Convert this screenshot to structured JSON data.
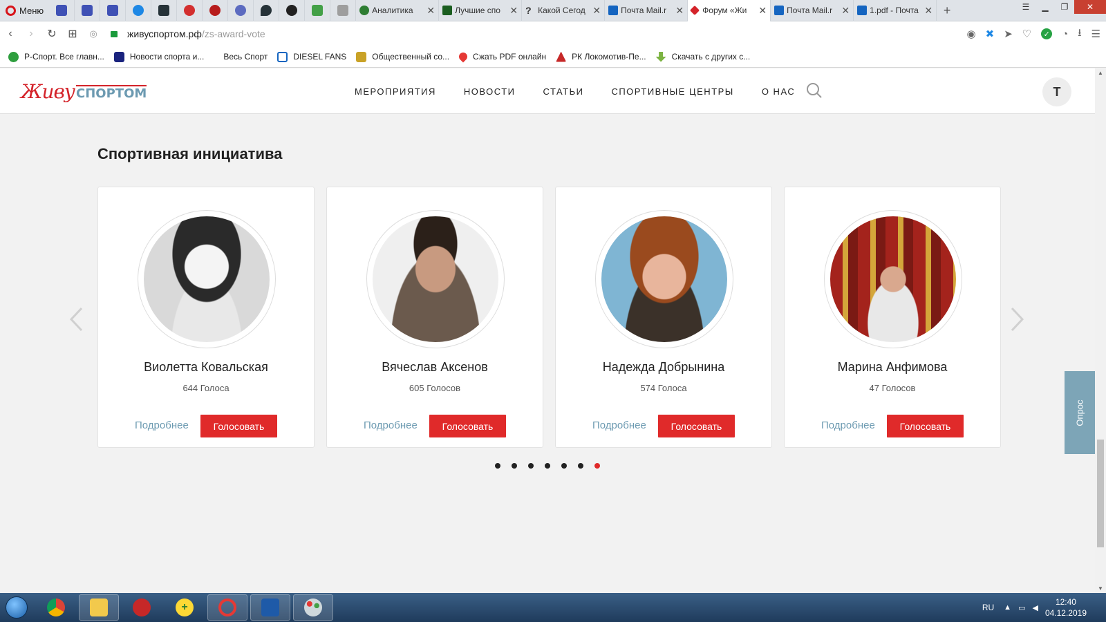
{
  "browser": {
    "menu_label": "Меню",
    "tabs": [
      {
        "label": "Аналитика",
        "color": "#2e7d32"
      },
      {
        "label": "Лучшие спо",
        "color": "#1b5e20"
      },
      {
        "label": "Какой Сегод",
        "color": "#222222"
      },
      {
        "label": "Почта Mail.r",
        "color": "#1565c0"
      },
      {
        "label": "Форум «Жи",
        "color": "#d4232a"
      },
      {
        "label": "Почта Mail.r",
        "color": "#1565c0"
      },
      {
        "label": "1.pdf - Почта",
        "color": "#1565c0"
      }
    ],
    "url_host": "живуспортом.рф",
    "url_path": "/zs-award-vote",
    "bookmarks": [
      {
        "label": "Р-Спорт. Все главн...",
        "color": "#2e9e3e"
      },
      {
        "label": "Новости спорта и...",
        "color": "#1a237e"
      },
      {
        "label": "Весь Спорт",
        "color": ""
      },
      {
        "label": "DIESEL FANS",
        "color": "#1565c0"
      },
      {
        "label": "Общественный со...",
        "color": "#c9a227"
      },
      {
        "label": "Сжать PDF онлайн",
        "color": "#e53935"
      },
      {
        "label": "РК Локомотив-Пе...",
        "color": "#c62828"
      },
      {
        "label": "Скачать с других с...",
        "color": "#7cb342"
      }
    ]
  },
  "site": {
    "logo_script": "Живу",
    "logo_block": "СПОРТОМ",
    "nav": [
      "МЕРОПРИЯТИЯ",
      "НОВОСТИ",
      "СТАТЬИ",
      "СПОРТИВНЫЕ ЦЕНТРЫ",
      "О НАС"
    ],
    "user_initial": "Т",
    "section_title": "Спортивная инициатива",
    "more_label": "Подробнее",
    "vote_label": "Голосовать",
    "candidates": [
      {
        "name": "Виолетта Ковальская",
        "votes": "644 Голоса"
      },
      {
        "name": "Вячеслав Аксенов",
        "votes": "605 Голосов"
      },
      {
        "name": "Надежда Добрынина",
        "votes": "574 Голоса"
      },
      {
        "name": "Марина Анфимова",
        "votes": "47 Голосов"
      }
    ],
    "pagination": {
      "total": 7,
      "active": 7
    },
    "poll_tab": "Опрос",
    "accent_color": "#e02a2a",
    "link_color": "#6c9ab1"
  },
  "taskbar": {
    "lang": "RU",
    "time": "12:40",
    "date": "04.12.2019"
  }
}
